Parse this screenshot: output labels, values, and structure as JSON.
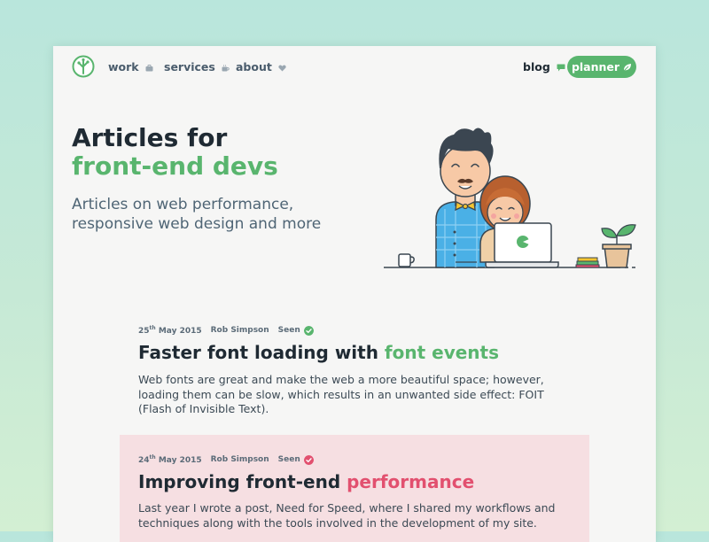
{
  "nav": {
    "links": [
      {
        "label": "work",
        "icon": "briefcase-icon"
      },
      {
        "label": "services",
        "icon": "coffee-icon"
      },
      {
        "label": "about",
        "icon": "heart-icon"
      }
    ],
    "blog": {
      "label": "blog",
      "icon": "speech-bubble-icon"
    },
    "planner": {
      "label": "planner",
      "icon": "leaf-icon"
    }
  },
  "hero": {
    "title_line1": "Articles for",
    "title_line2": "front-end devs",
    "subtitle": "Articles on web performance, responsive web design and more"
  },
  "articles": [
    {
      "day": "25",
      "suffix": "th",
      "month_year": "May 2015",
      "author": "Rob Simpson",
      "status": "Seen",
      "title_plain": "Faster font loading with ",
      "title_accent": "font events",
      "excerpt": "Web fonts are great and make the web a more beautiful space; however, loading them can be slow, which results in an unwanted side effect: FOIT (Flash of Invisible Text)."
    },
    {
      "day": "24",
      "suffix": "th",
      "month_year": "May 2015",
      "author": "Rob Simpson",
      "status": "Seen",
      "title_plain": "Improving front-end ",
      "title_accent": "performance",
      "excerpt": "Last year I wrote a post, Need for Speed, where I shared my workflows and techniques along with the tools involved in the development of my site."
    }
  ],
  "colors": {
    "accent_green": "#59b56e",
    "accent_pink": "#e2506f",
    "text_dark": "#1f2a33",
    "highlight_bg": "#f6dfe2"
  }
}
